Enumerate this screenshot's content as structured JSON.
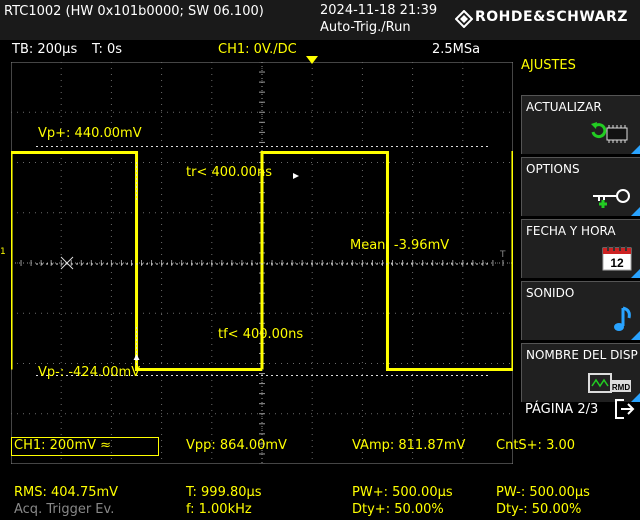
{
  "header": {
    "device": "RTC1002 (HW 0x101b0000; SW 06.100)",
    "datetime": "2024-11-18 21:39",
    "status": "Auto-Trig./Run",
    "brand": "ROHDE&SCHWARZ"
  },
  "infobar": {
    "timebase": "TB: 200µs",
    "trigger_time": "T: 0s",
    "channel": "CH1: 0V./DC",
    "sample_rate": "2.5MSa"
  },
  "menu": {
    "title": "AJUSTES",
    "items": [
      {
        "label": "ACTUALIZAR",
        "icon": "update-chip-icon"
      },
      {
        "label": "OPTIONS",
        "icon": "key-icon"
      },
      {
        "label": "FECHA Y HORA",
        "icon": "calendar-icon",
        "icon_text": "12"
      },
      {
        "label": "SONIDO",
        "icon": "music-note-icon"
      },
      {
        "label": "NOMBRE DEL DISP",
        "icon": "device-name-icon",
        "icon_text": "RMD"
      }
    ],
    "page": "PÁGINA 2/3"
  },
  "waveform": {
    "vp_plus": "Vp+: 440.00mV",
    "vp_minus": "Vp-: -424.00mV",
    "tr": "tr< 400.00ns",
    "tf": "tf< 400.00ns",
    "mean": "Mean: -3.96mV",
    "ch_marker": "1",
    "trig_marker": "T",
    "high_mV": 440,
    "low_mV": -424,
    "period_us": 999.8,
    "duty": 0.5
  },
  "measurements": {
    "ch1": "CH1: 200mV",
    "ch1_symbol": "≈",
    "rms": "RMS: 404.75mV",
    "acq": "Acq. Trigger Ev.",
    "vpp": "Vpp: 864.00mV",
    "period": "T: 999.80µs",
    "freq": "f: 1.00kHz",
    "vamp": "VAmp: 811.87mV",
    "pw_plus": "PW+: 500.00µs",
    "dty_plus": "Dty+: 50.00%",
    "cnts": "CntS+: 3.00",
    "pw_minus": "PW-: 500.00µs",
    "dty_minus": "Dty-: 50.00%"
  },
  "colors": {
    "trace": "#ffff00",
    "accent": "#29a3ff",
    "grid": "#6a6a6a"
  }
}
